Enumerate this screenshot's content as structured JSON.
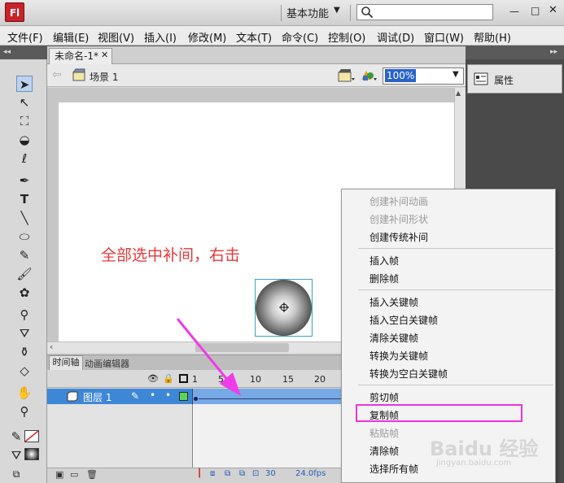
{
  "app": {
    "logo": "Fl",
    "workspace": "基本功能",
    "search_placeholder": ""
  },
  "menu": [
    "文件(F)",
    "编辑(E)",
    "视图(V)",
    "插入(I)",
    "修改(M)",
    "文本(T)",
    "命令(C)",
    "控制(O)",
    "调试(D)",
    "窗口(W)",
    "帮助(H)"
  ],
  "document": {
    "tab_title": "未命名-1*",
    "scene": "场景 1",
    "zoom": "100%"
  },
  "annotation": "全部选中补间，右击",
  "timeline": {
    "tabs": [
      "时间轴",
      "动画编辑器"
    ],
    "ruler": [
      "1",
      "5",
      "10",
      "15",
      "20"
    ],
    "layer_name": "图层 1",
    "status_frame": "30",
    "status_fps": "24.0fps"
  },
  "properties": {
    "label": "属性"
  },
  "context_menu": {
    "items": [
      {
        "label": "创建补间动画",
        "enabled": false
      },
      {
        "label": "创建补间形状",
        "enabled": false
      },
      {
        "label": "创建传统补间",
        "enabled": true
      },
      {
        "label": "插入帧",
        "enabled": true
      },
      {
        "label": "删除帧",
        "enabled": true
      },
      {
        "label": "插入关键帧",
        "enabled": true
      },
      {
        "label": "插入空白关键帧",
        "enabled": true
      },
      {
        "label": "清除关键帧",
        "enabled": true
      },
      {
        "label": "转换为关键帧",
        "enabled": true
      },
      {
        "label": "转换为空白关键帧",
        "enabled": true
      },
      {
        "label": "剪切帧",
        "enabled": true
      },
      {
        "label": "复制帧",
        "enabled": true,
        "highlighted": true
      },
      {
        "label": "粘贴帧",
        "enabled": false
      },
      {
        "label": "清除帧",
        "enabled": true
      },
      {
        "label": "选择所有帧",
        "enabled": true
      }
    ]
  },
  "watermark": {
    "text": "Baidu 经验",
    "sub": "jingyan.baidu.com"
  },
  "colors": {
    "annotation": "#e8383a",
    "highlight": "#ec33e2",
    "layer_selected": "#3d87d6",
    "logo": "#c8232c"
  }
}
